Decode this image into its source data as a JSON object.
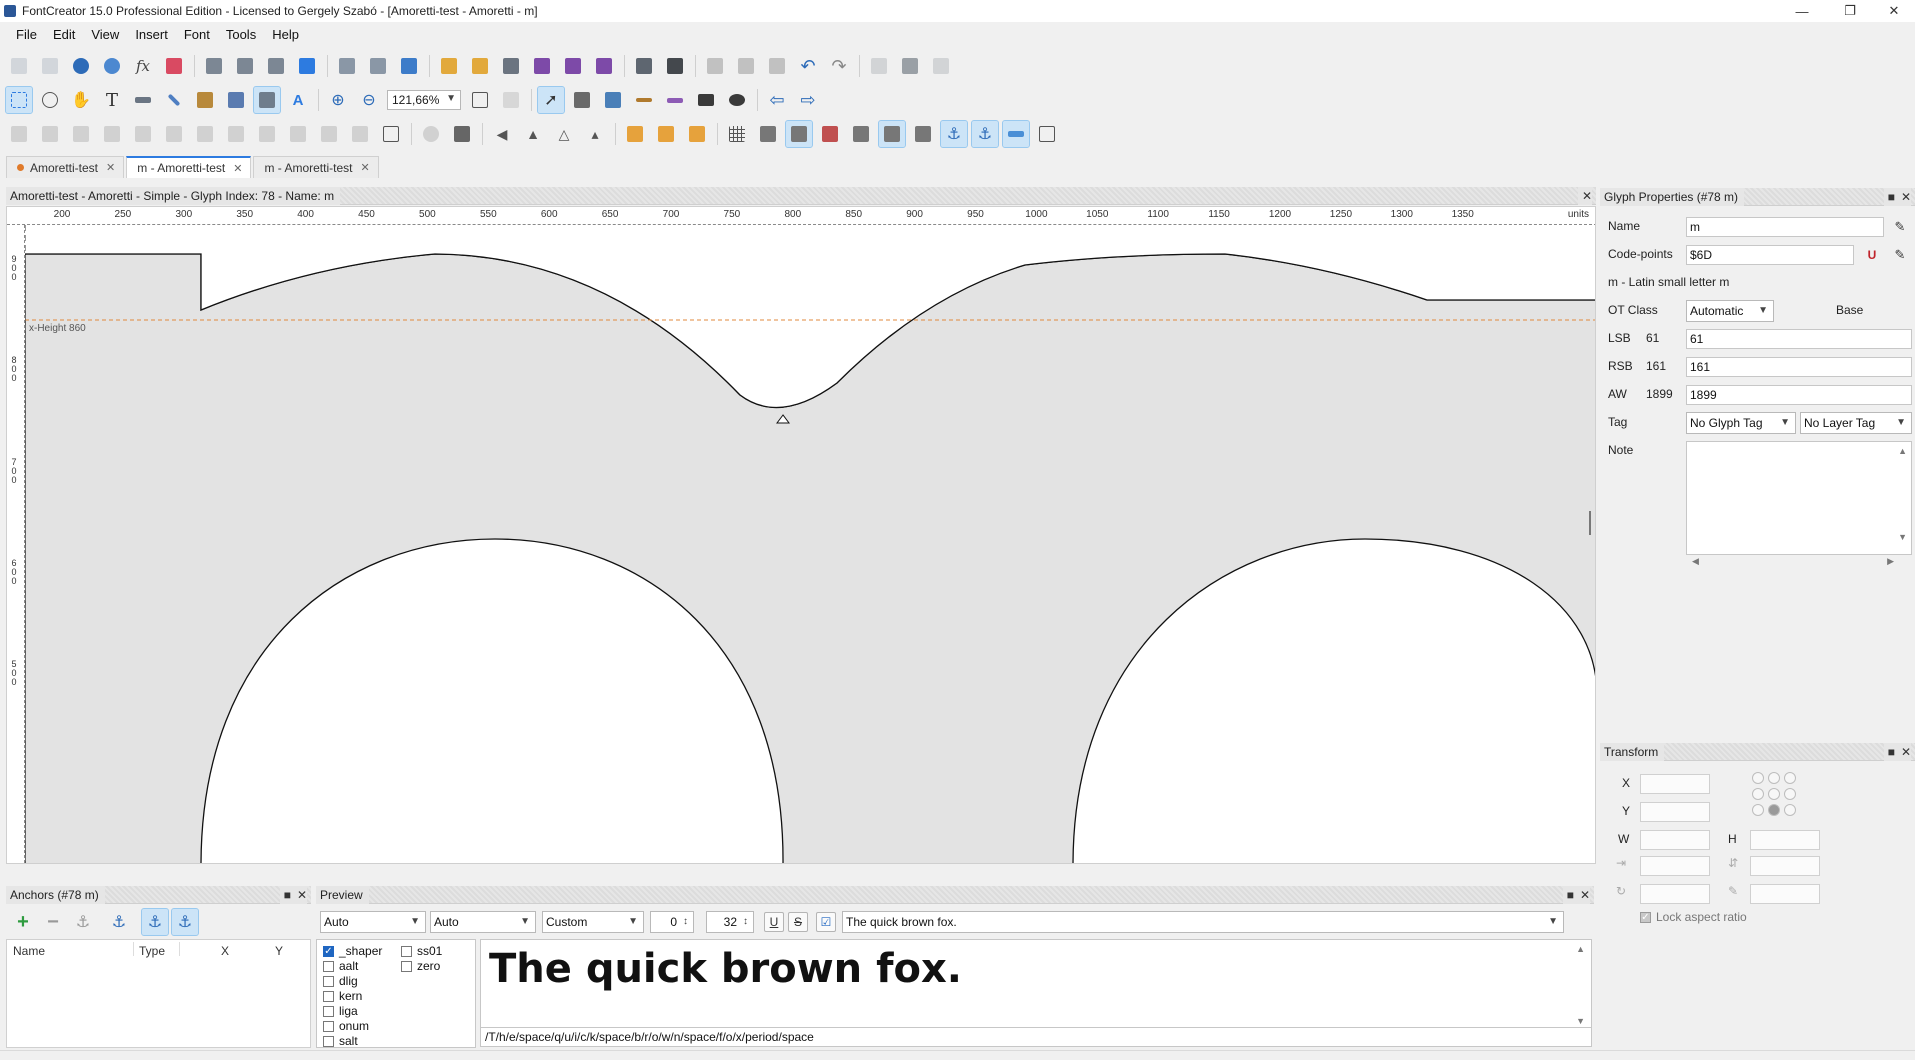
{
  "window": {
    "title": "FontCreator 15.0 Professional Edition - Licensed to Gergely Szabó - [Amoretti-test - Amoretti - m]"
  },
  "menu": [
    "File",
    "Edit",
    "View",
    "Insert",
    "Font",
    "Tools",
    "Help"
  ],
  "toolbar": {
    "zoom": "121,66%"
  },
  "tabs": [
    {
      "label": "Amoretti-test",
      "active": false
    },
    {
      "label": "m - Amoretti-test",
      "active": true
    },
    {
      "label": "m - Amoretti-test",
      "active": false
    }
  ],
  "editor": {
    "header": "Amoretti-test - Amoretti - Simple - Glyph Index: 78 - Name: m",
    "ruler_ticks": [
      "200",
      "250",
      "300",
      "350",
      "400",
      "450",
      "500",
      "550",
      "600",
      "650",
      "700",
      "750",
      "800",
      "850",
      "900",
      "950",
      "1000",
      "1050",
      "1100",
      "1150",
      "1200",
      "1250",
      "1300",
      "1350"
    ],
    "ruler_units": "units",
    "vruler_ticks": [
      "900",
      "800",
      "700",
      "600",
      "500"
    ],
    "xheight_label": "x-Height 860"
  },
  "glyph_properties": {
    "title": "Glyph Properties (#78 m)",
    "name_label": "Name",
    "name": "m",
    "codepoints_label": "Code-points",
    "codepoints": "$6D",
    "description": "m - Latin small letter m",
    "otclass_label": "OT Class",
    "otclass": "Automatic",
    "otclass_value": "Base",
    "lsb_label": "LSB",
    "lsb_current": "61",
    "lsb": "61",
    "rsb_label": "RSB",
    "rsb_current": "161",
    "rsb": "161",
    "aw_label": "AW",
    "aw_current": "1899",
    "aw": "1899",
    "tag_label": "Tag",
    "glyph_tag": "No Glyph Tag",
    "layer_tag": "No Layer Tag",
    "note_label": "Note"
  },
  "transform": {
    "title": "Transform",
    "x_label": "X",
    "y_label": "Y",
    "w_label": "W",
    "h_label": "H",
    "lock_label": "Lock aspect ratio"
  },
  "anchors": {
    "title": "Anchors (#78 m)",
    "columns": [
      "Name",
      "Type",
      "X",
      "Y"
    ]
  },
  "preview": {
    "title": "Preview",
    "script": "Auto",
    "language": "Auto",
    "mode": "Custom",
    "spacing": "0",
    "size": "32",
    "text": "The quick brown fox.",
    "features": [
      {
        "name": "_shaper",
        "checked": true
      },
      {
        "name": "aalt",
        "checked": false
      },
      {
        "name": "dlig",
        "checked": false
      },
      {
        "name": "kern",
        "checked": false
      },
      {
        "name": "liga",
        "checked": false
      },
      {
        "name": "onum",
        "checked": false
      },
      {
        "name": "salt",
        "checked": false
      },
      {
        "name": "ss01",
        "checked": false
      },
      {
        "name": "zero",
        "checked": false
      }
    ],
    "glyph_path": "/T/h/e/space/q/u/i/c/k/space/b/r/o/w/n/space/f/o/x/period/space"
  },
  "colors": {
    "accent": "#2d7be0",
    "xheight_line": "#e08a3c",
    "glyph_fill": "#e3e3e3"
  }
}
